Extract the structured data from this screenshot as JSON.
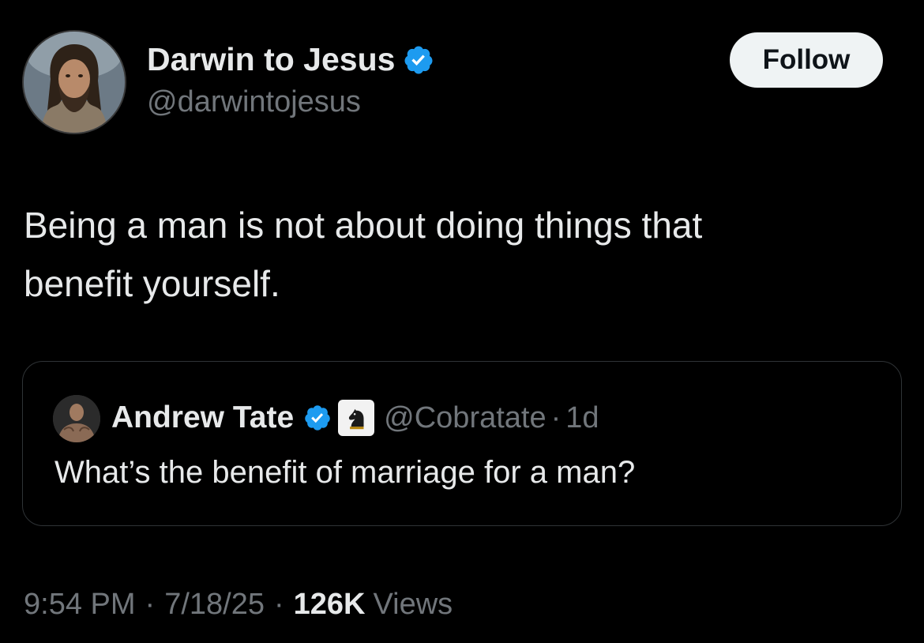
{
  "tweet": {
    "author": {
      "name": "Darwin to Jesus",
      "handle": "@darwintojesus",
      "verified": true,
      "avatar_icon": "bearded-man-portrait"
    },
    "follow_label": "Follow",
    "text": "Being a man is not about doing things that\nbenefit yourself.",
    "quoted": {
      "name": "Andrew Tate",
      "handle": "@Cobratate",
      "dot": "·",
      "time": "1d",
      "text": "What’s the benefit of marriage for a man?",
      "verified": true,
      "badge_icon": "chess-knight-badge"
    },
    "meta": {
      "time": "9:54 PM",
      "sep1": "·",
      "date": "7/18/25",
      "sep2": "·",
      "views_count": "126K",
      "views_label": "Views"
    }
  },
  "colors": {
    "background": "#000000",
    "text_primary": "#e7e9ea",
    "text_secondary": "#71767b",
    "verified_blue": "#1d9bf0",
    "follow_button_bg": "#eff3f4",
    "card_border": "#2f3336"
  }
}
